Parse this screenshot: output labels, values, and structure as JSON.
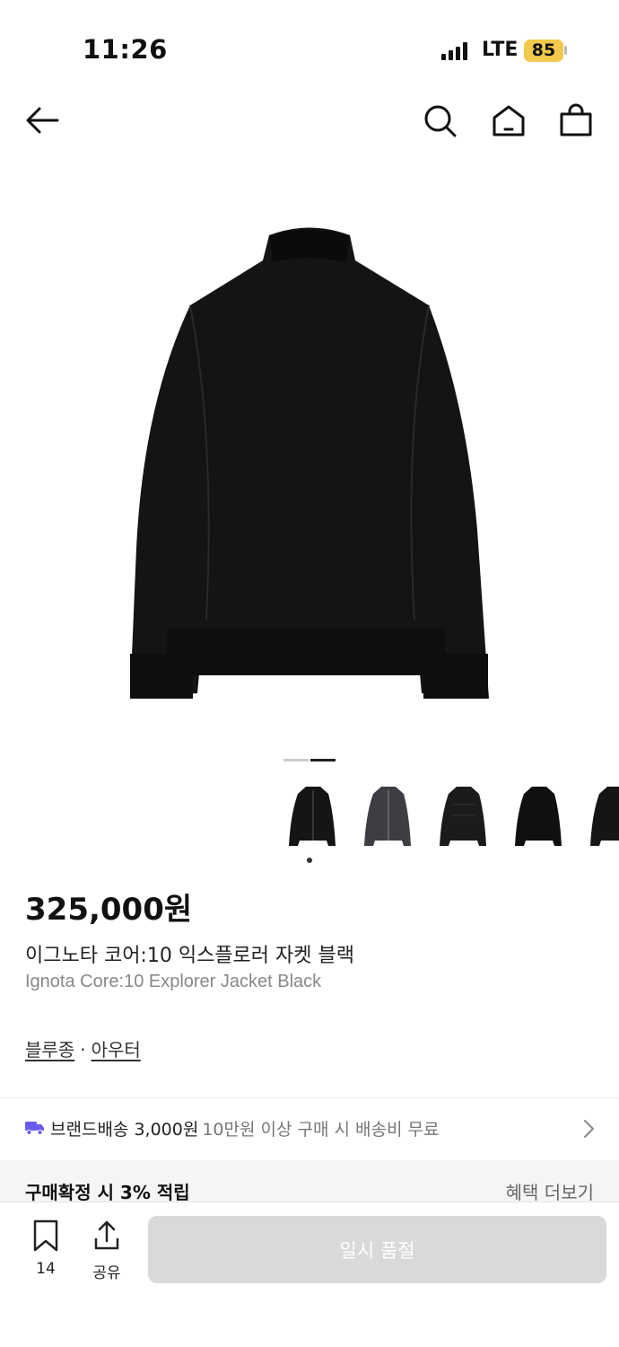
{
  "status": {
    "time": "11:26",
    "network": "LTE",
    "battery": "85",
    "battery_color": "#f2c94c"
  },
  "nav": {
    "back_icon": "arrow-left-icon",
    "search_icon": "search-icon",
    "home_icon": "home-icon",
    "cart_icon": "shopping-bag-icon"
  },
  "gallery": {
    "current_index": 1,
    "total": 2,
    "thumbnails": [
      "jacket-black-zip",
      "jacket-grey-zip",
      "jacket-black-quilted",
      "jacket-black-collar",
      "jacket-black-partial"
    ],
    "selected_thumbnail": 0
  },
  "product": {
    "price": "325,000원",
    "name_ko": "이그노타 코어:10 익스플로러 자켓 블랙",
    "name_en": "Ignota Core:10 Explorer Jacket Black",
    "category_1": "블루종",
    "category_separator": "·",
    "category_2": "아우터"
  },
  "shipping": {
    "label": "브랜드배송 3,000원",
    "note": "10만원 이상 구매 시 배송비 무료",
    "icon": "truck-icon",
    "icon_color": "#6b5cf0"
  },
  "benefit": {
    "label": "구매확정 시 3% 적립",
    "more": "혜택 더보기"
  },
  "bottom": {
    "bookmark_count": "14",
    "share_label": "공유",
    "buy_label": "일시 품절"
  }
}
